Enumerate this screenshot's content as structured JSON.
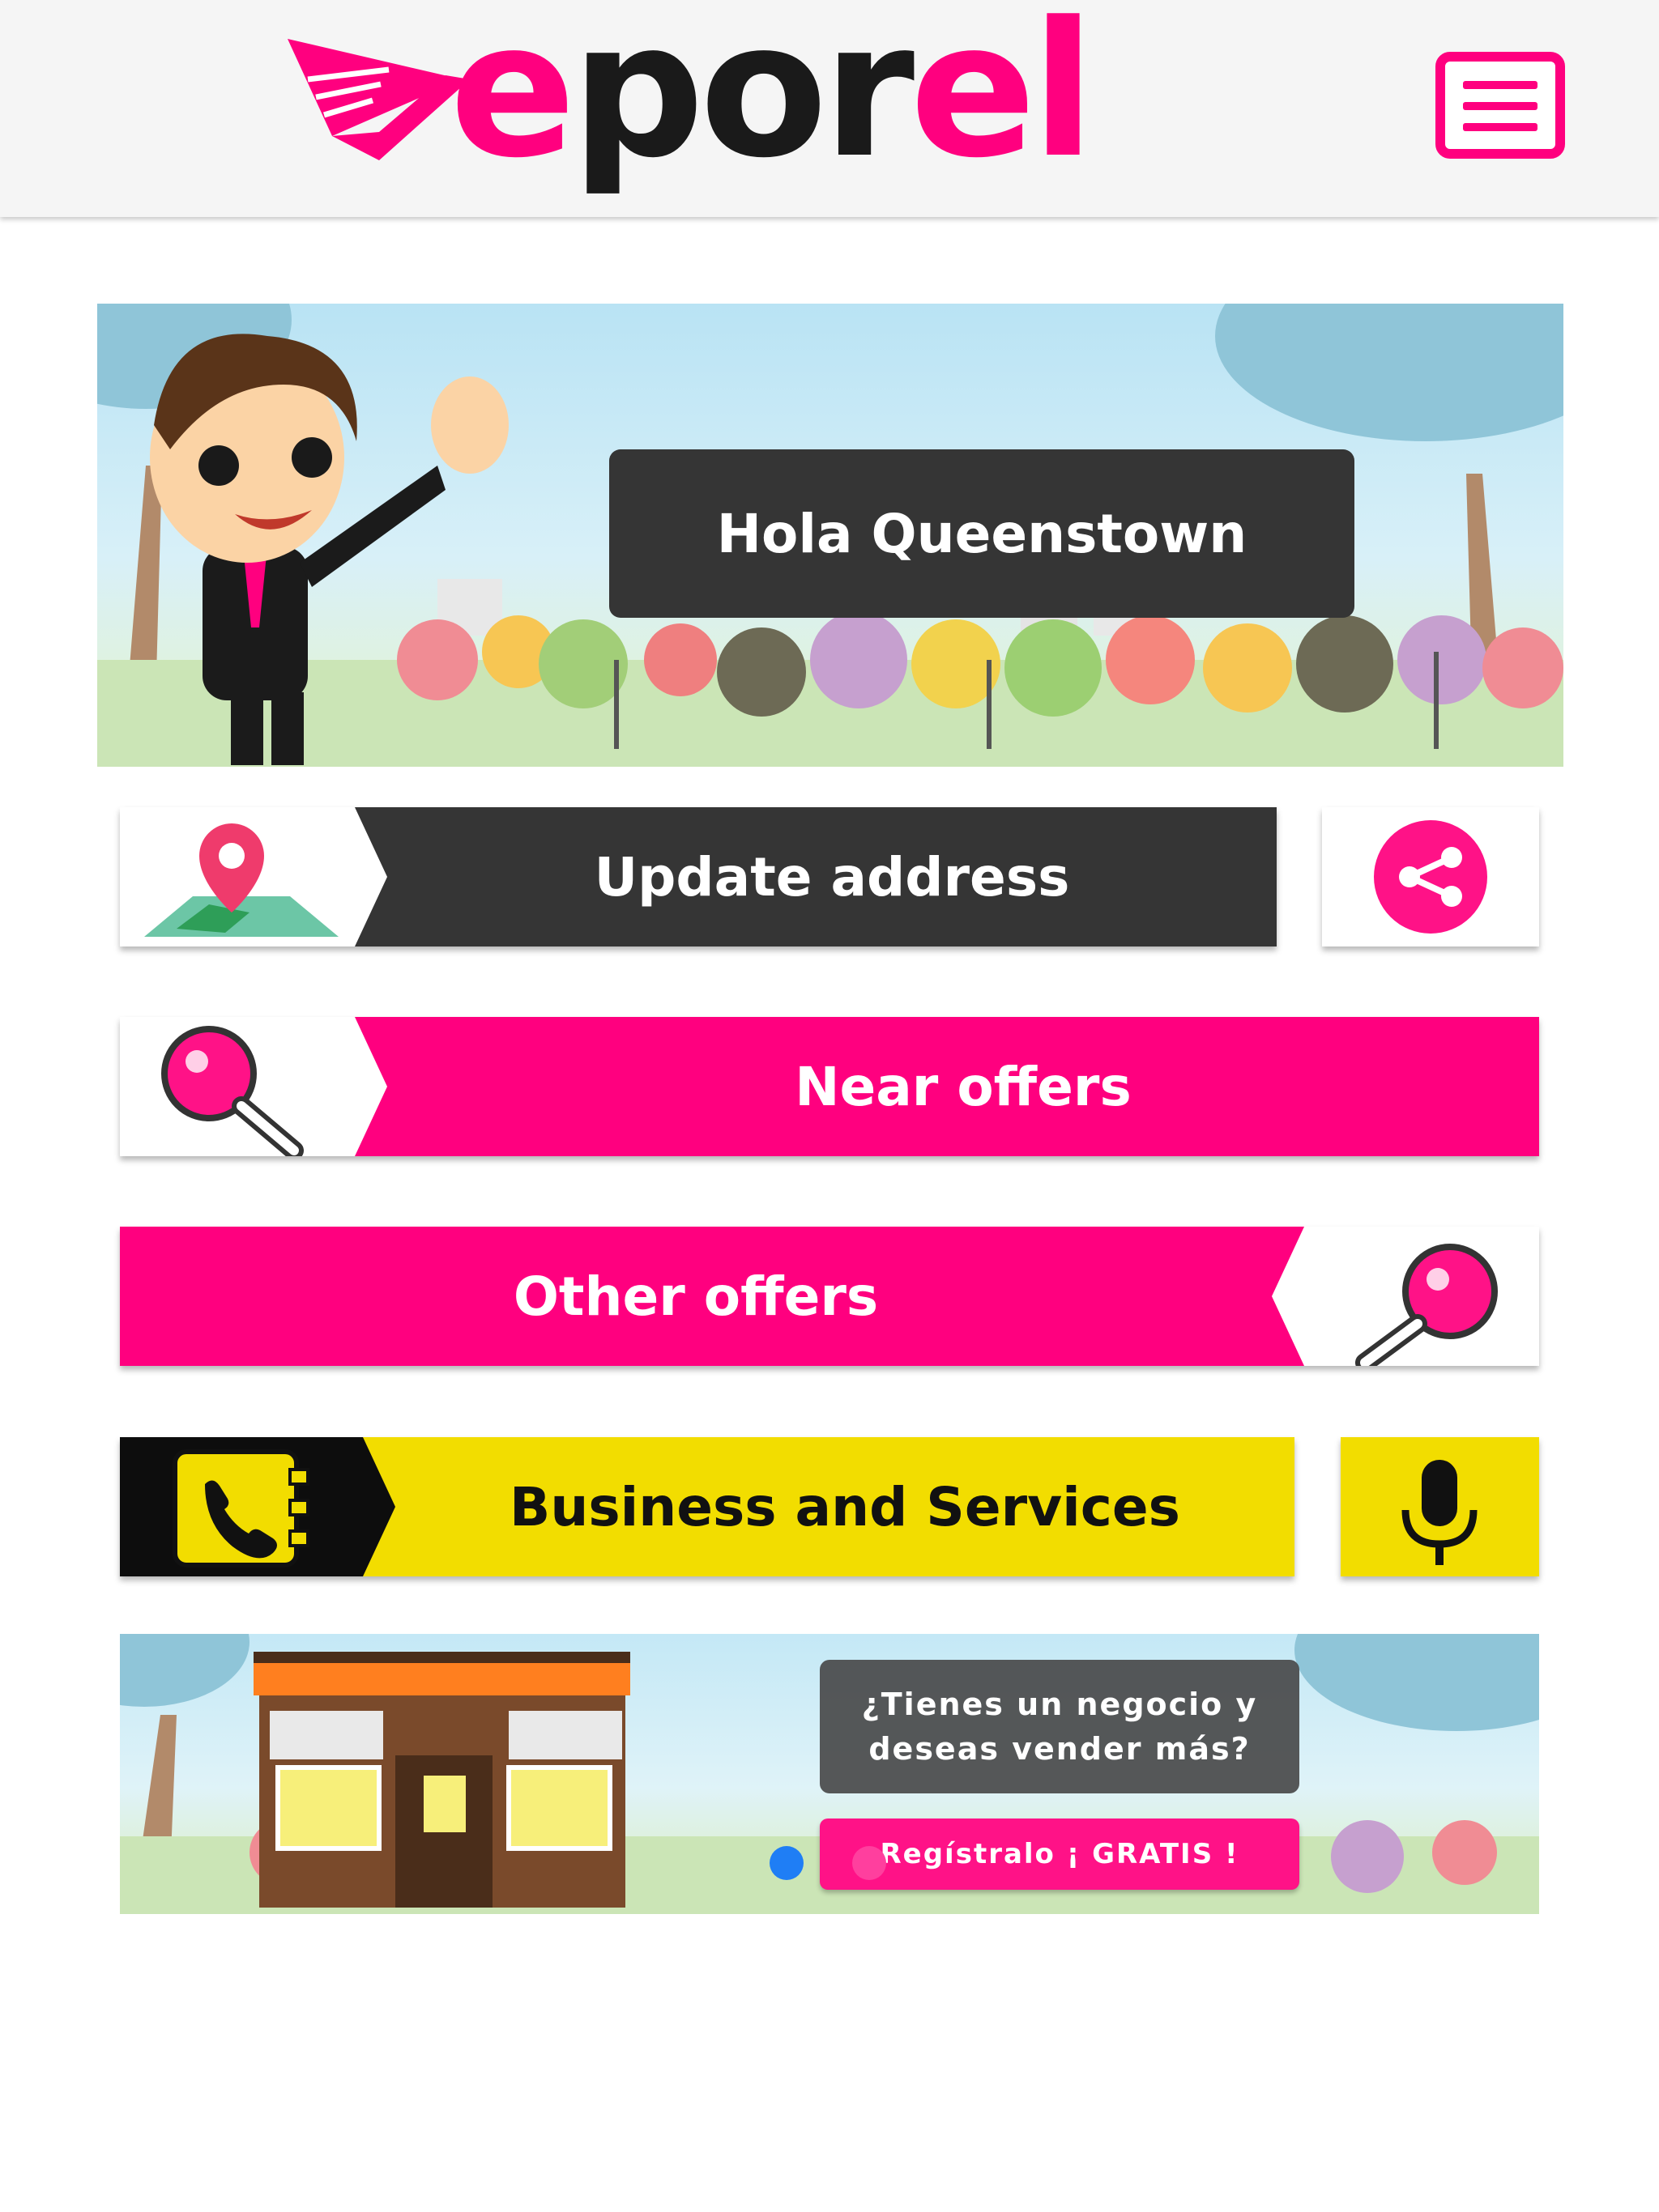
{
  "brand": {
    "name": "veporel",
    "accent_color": "#ff007f"
  },
  "header": {
    "menu_icon": "hamburger-menu-icon"
  },
  "hero": {
    "greeting": "Hola Queenstown",
    "character": "waving-man-illustration"
  },
  "actions": {
    "update_address": {
      "label": "Update address",
      "icon": "map-pin-icon",
      "color": "#353535"
    },
    "share": {
      "icon": "share-icon"
    },
    "near_offers": {
      "label": "Near offers",
      "icon": "magnifier-icon",
      "color": "#ff007f"
    },
    "other_offers": {
      "label": "Other offers",
      "icon": "magnifier-icon",
      "color": "#ff007f"
    },
    "business_services": {
      "label": "Business and Services",
      "icon": "phonebook-icon",
      "color": "#f2dd00"
    },
    "voice": {
      "icon": "microphone-icon"
    }
  },
  "promo": {
    "question": "¿Tienes un negocio y\ndeseas vender más?",
    "cta": "Regístralo ¡ GRATIS !",
    "slides": 2,
    "active_slide": 1
  }
}
